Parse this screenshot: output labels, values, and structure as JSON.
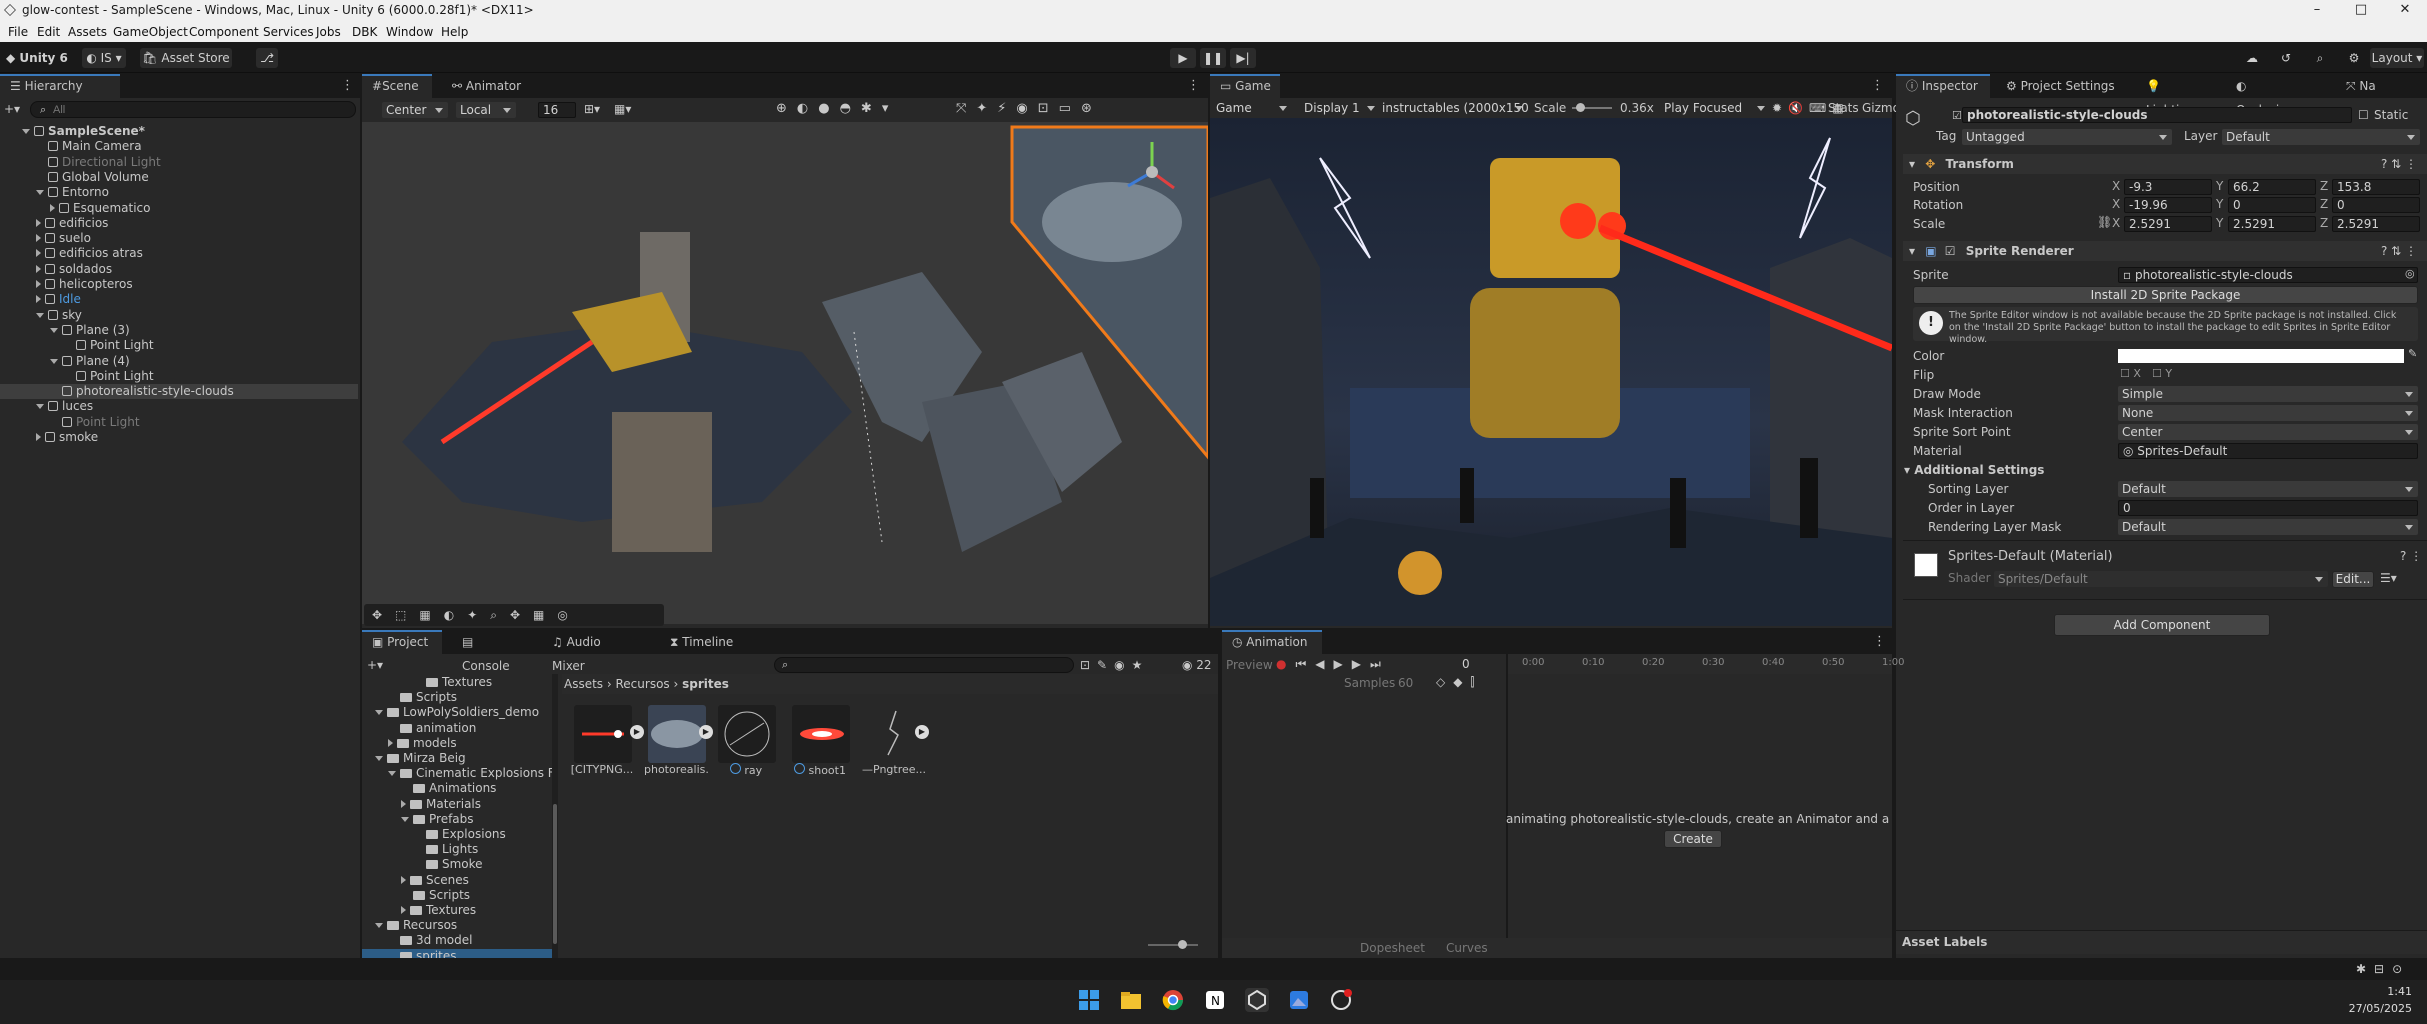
{
  "window": {
    "title": "glow-contest - SampleScene - Windows, Mac, Linux - Unity 6 (6000.0.28f1)* <DX11>",
    "controls": {
      "minimize": "–",
      "maximize": "□",
      "close": "✕"
    }
  },
  "menu": [
    "File",
    "Edit",
    "Assets",
    "GameObject",
    "Component",
    "Services",
    "Jobs",
    "DBK",
    "Window",
    "Help"
  ],
  "toolbar": {
    "account": "Unity 6",
    "user": "IS",
    "asset_store": "Asset Store",
    "layout": "Layout"
  },
  "hierarchy": {
    "tab": "Hierarchy",
    "search_placeholder": "All",
    "items": [
      {
        "label": "SampleScene*",
        "depth": 0,
        "kind": "scene",
        "style": "bold",
        "arrow": "down"
      },
      {
        "label": "Main Camera",
        "depth": 1,
        "kind": "object",
        "style": "",
        "arrow": ""
      },
      {
        "label": "Directional Light",
        "depth": 1,
        "kind": "object",
        "style": "dim",
        "arrow": ""
      },
      {
        "label": "Global Volume",
        "depth": 1,
        "kind": "object",
        "style": "",
        "arrow": ""
      },
      {
        "label": "Entorno",
        "depth": 1,
        "kind": "object",
        "style": "",
        "arrow": "down"
      },
      {
        "label": "Esquematico",
        "depth": 2,
        "kind": "object",
        "style": "",
        "arrow": "right"
      },
      {
        "label": "edificios",
        "depth": 1,
        "kind": "object",
        "style": "",
        "arrow": "right"
      },
      {
        "label": "suelo",
        "depth": 1,
        "kind": "object",
        "style": "",
        "arrow": "right"
      },
      {
        "label": "edificios atras",
        "depth": 1,
        "kind": "object",
        "style": "",
        "arrow": "right"
      },
      {
        "label": "soldados",
        "depth": 1,
        "kind": "object",
        "style": "",
        "arrow": "right"
      },
      {
        "label": "helicopteros",
        "depth": 1,
        "kind": "object",
        "style": "",
        "arrow": "right"
      },
      {
        "label": "Idle",
        "depth": 1,
        "kind": "object",
        "style": "blue",
        "arrow": "right"
      },
      {
        "label": "sky",
        "depth": 1,
        "kind": "object",
        "style": "",
        "arrow": "down"
      },
      {
        "label": "Plane (3)",
        "depth": 2,
        "kind": "object",
        "style": "",
        "arrow": "down"
      },
      {
        "label": "Point Light",
        "depth": 3,
        "kind": "object",
        "style": "",
        "arrow": ""
      },
      {
        "label": "Plane (4)",
        "depth": 2,
        "kind": "object",
        "style": "",
        "arrow": "down"
      },
      {
        "label": "Point Light",
        "depth": 3,
        "kind": "object",
        "style": "",
        "arrow": ""
      },
      {
        "label": "photorealistic-style-clouds",
        "depth": 2,
        "kind": "object",
        "style": "sel",
        "arrow": ""
      },
      {
        "label": "luces",
        "depth": 1,
        "kind": "object",
        "style": "",
        "arrow": "down"
      },
      {
        "label": "Point Light",
        "depth": 2,
        "kind": "object",
        "style": "dim",
        "arrow": ""
      },
      {
        "label": "smoke",
        "depth": 1,
        "kind": "object",
        "style": "",
        "arrow": "right"
      }
    ]
  },
  "scene": {
    "tabs": [
      "Scene",
      "Animator"
    ],
    "pivot": "Center",
    "space": "Local",
    "snap": "16"
  },
  "game": {
    "tab": "Game",
    "mode": "Game",
    "display": "Display 1",
    "resolution": "instructables (2000x1500)",
    "scale_label": "Scale",
    "scale_value": "0.36x",
    "play_mode": "Play Focused",
    "stats": "Stats",
    "gizmos": "Gizmo"
  },
  "inspector": {
    "tabs": [
      "Inspector",
      "Project Settings",
      "Lighting",
      "Occlusion",
      "Na"
    ],
    "object_name": "photorealistic-style-clouds",
    "static_label": "Static",
    "tag_label": "Tag",
    "tag_value": "Untagged",
    "layer_label": "Layer",
    "layer_value": "Default",
    "transform": {
      "title": "Transform",
      "position_label": "Position",
      "position": [
        "-9.3",
        "66.2",
        "153.8"
      ],
      "rotation_label": "Rotation",
      "rotation": [
        "-19.96",
        "0",
        "0"
      ],
      "scale_label": "Scale",
      "scale": [
        "2.5291",
        "2.5291",
        "2.5291"
      ]
    },
    "sprite_renderer": {
      "title": "Sprite Renderer",
      "sprite_label": "Sprite",
      "sprite_value": "photorealistic-style-clouds",
      "install_button": "Install 2D Sprite Package",
      "warning": "The Sprite Editor window is not available because the 2D Sprite package is not installed. Click on the 'Install 2D Sprite Package' button to install the package to edit Sprites in Sprite Editor window.",
      "color_label": "Color",
      "flip_label": "Flip",
      "draw_mode_label": "Draw Mode",
      "draw_mode": "Simple",
      "mask_label": "Mask Interaction",
      "mask": "None",
      "sort_point_label": "Sprite Sort Point",
      "sort_point": "Center",
      "material_label": "Material",
      "material": "Sprites-Default",
      "additional": "Additional Settings",
      "sorting_layer_label": "Sorting Layer",
      "sorting_layer": "Default",
      "order_label": "Order in Layer",
      "order": "0",
      "render_mask_label": "Rendering Layer Mask",
      "render_mask": "Default"
    },
    "material": {
      "name": "Sprites-Default (Material)",
      "shader_label": "Shader",
      "shader": "Sprites/Default",
      "edit": "Edit..."
    },
    "add_component": "Add Component",
    "asset_labels": "Asset Labels"
  },
  "project": {
    "tabs": [
      "Project",
      "Console",
      "Audio Mixer",
      "Timeline"
    ],
    "count": "22",
    "tree": [
      {
        "label": "Textures",
        "depth": 4,
        "arrow": ""
      },
      {
        "label": "Scripts",
        "depth": 2,
        "arrow": ""
      },
      {
        "label": "LowPolySoldiers_demo",
        "depth": 1,
        "arrow": "down"
      },
      {
        "label": "animation",
        "depth": 2,
        "arrow": ""
      },
      {
        "label": "models",
        "depth": 2,
        "arrow": "right"
      },
      {
        "label": "Mirza Beig",
        "depth": 1,
        "arrow": "down"
      },
      {
        "label": "Cinematic Explosions FI",
        "depth": 2,
        "arrow": "down"
      },
      {
        "label": "Animations",
        "depth": 3,
        "arrow": ""
      },
      {
        "label": "Materials",
        "depth": 3,
        "arrow": "right"
      },
      {
        "label": "Prefabs",
        "depth": 3,
        "arrow": "down"
      },
      {
        "label": "Explosions",
        "depth": 4,
        "arrow": ""
      },
      {
        "label": "Lights",
        "depth": 4,
        "arrow": ""
      },
      {
        "label": "Smoke",
        "depth": 4,
        "arrow": ""
      },
      {
        "label": "Scenes",
        "depth": 3,
        "arrow": "right"
      },
      {
        "label": "Scripts",
        "depth": 3,
        "arrow": ""
      },
      {
        "label": "Textures",
        "depth": 3,
        "arrow": "right"
      },
      {
        "label": "Recursos",
        "depth": 1,
        "arrow": "down"
      },
      {
        "label": "3d model",
        "depth": 2,
        "arrow": ""
      },
      {
        "label": "sprites",
        "depth": 2,
        "arrow": ""
      }
    ],
    "breadcrumb": [
      "Assets",
      "Recursos",
      "sprites"
    ],
    "assets": [
      "[CITYPNG...",
      "photorealis...",
      "ray",
      "shoot1",
      "—Pngtree..."
    ]
  },
  "animation": {
    "tab": "Animation",
    "preview": "Preview",
    "frame": "0",
    "samples_label": "Samples",
    "samples": "60",
    "ticks": [
      "0:00",
      "0:10",
      "0:20",
      "0:30",
      "0:40",
      "0:50",
      "1:00"
    ],
    "message": "animating photorealistic-style-clouds, create an Animator and an Anim",
    "create": "Create",
    "dopesheet": "Dopesheet",
    "curves": "Curves"
  },
  "taskbar": {
    "time": "1:41",
    "date": "27/05/2025"
  },
  "colors": {
    "accent": "#3a79bb",
    "selection": "#2c5d87",
    "bg": "#282828"
  }
}
